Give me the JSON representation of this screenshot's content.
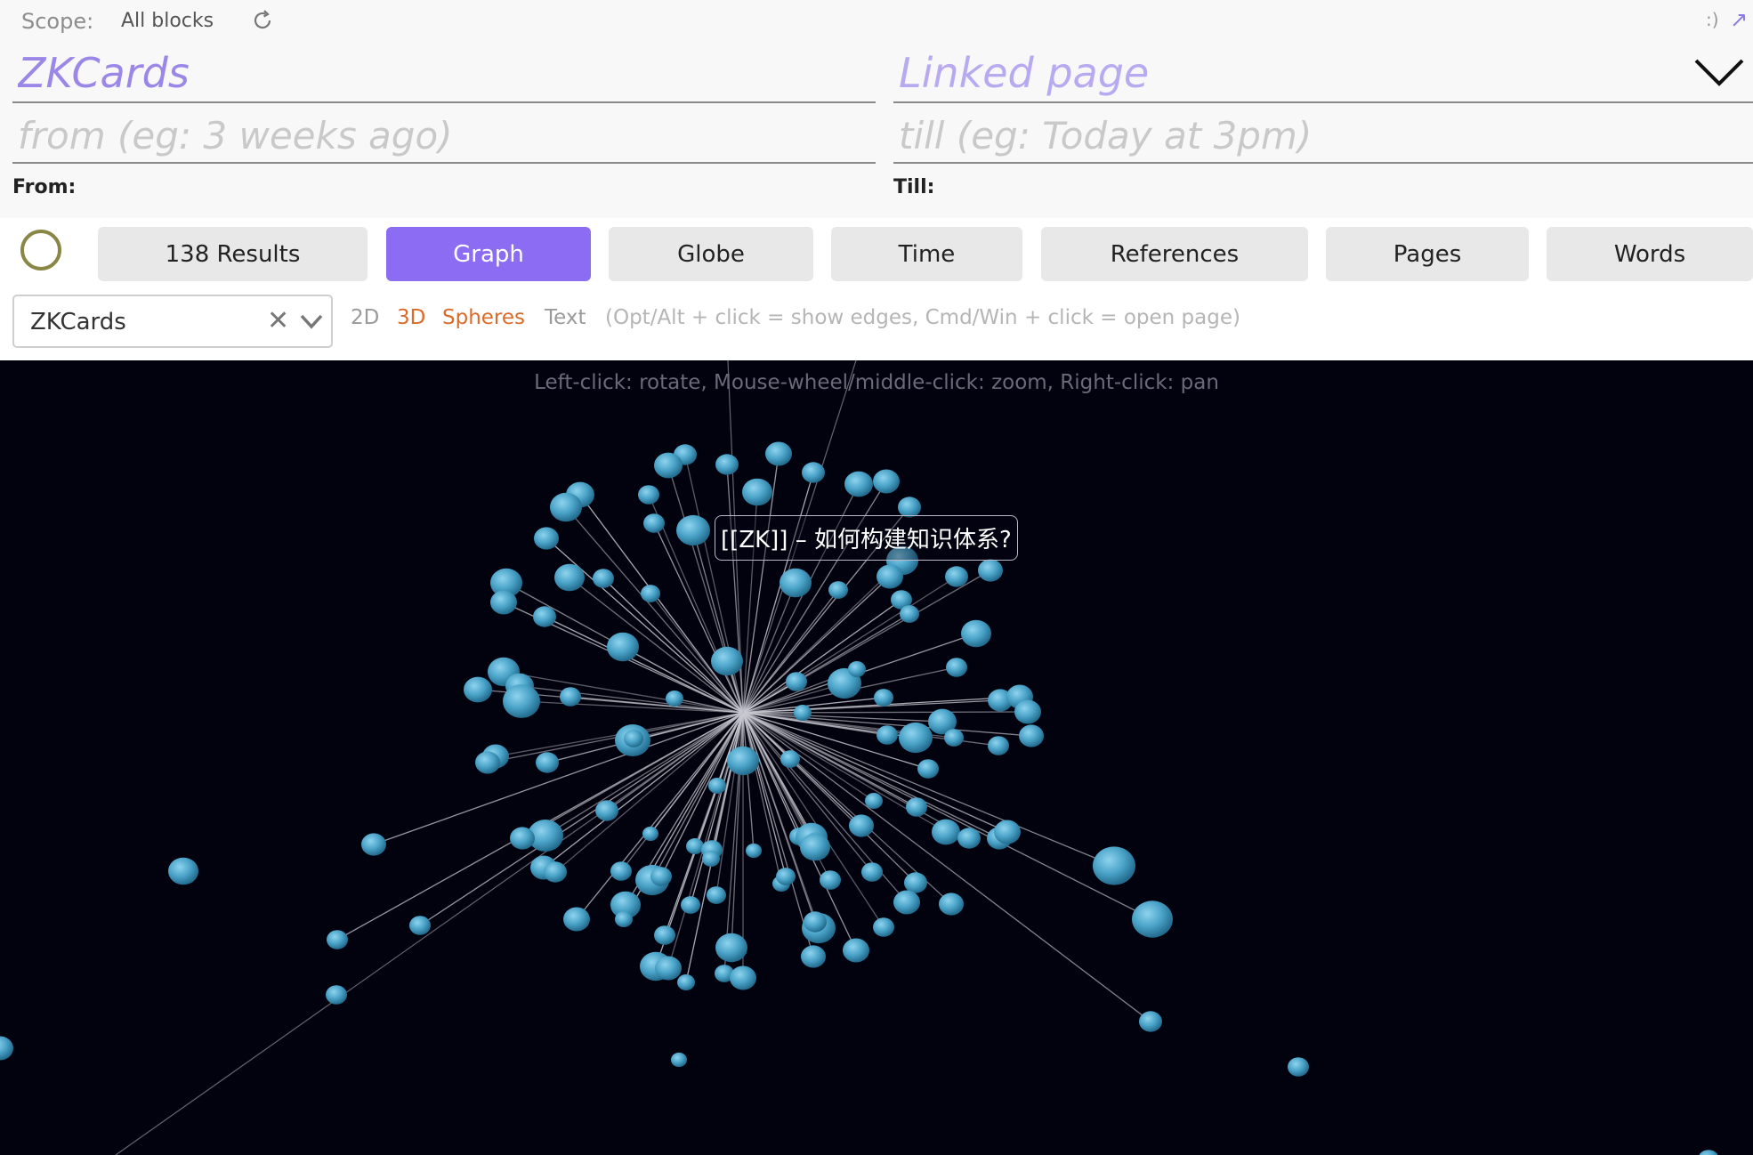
{
  "scope": {
    "label": "Scope:",
    "value": "All blocks"
  },
  "corner": {
    "smile": ":)",
    "arrow": "↗"
  },
  "query": {
    "title_value": "ZKCards",
    "linked_placeholder": "Linked page"
  },
  "dates": {
    "from_placeholder": "from (eg: 3 weeks ago)",
    "till_placeholder": "till (eg: Today at 3pm)",
    "from_label": "From:",
    "till_label": "Till:"
  },
  "tabs": [
    "138 Results",
    "Graph",
    "Globe",
    "Time",
    "References",
    "Pages",
    "Words"
  ],
  "active_tab": "Graph",
  "select": {
    "value": "ZKCards",
    "clear": "✕"
  },
  "view_options": {
    "dim2": "2D",
    "dim3": "3D",
    "spheres": "Spheres",
    "text": "Text",
    "hint": "(Opt/Alt + click = show edges, Cmd/Win + click = open page)"
  },
  "graph": {
    "hint": "Left-click: rotate, Mouse-wheel/middle-click: zoom, Right-click: pan",
    "tooltip": "[[ZK]] – 如何构建知识体系?"
  },
  "colors": {
    "accent": "#8b6cf2",
    "node": "#4aa3c8",
    "edge": "#c8c8d0",
    "graph_bg": "#02010e",
    "option_active": "#d96b2b"
  },
  "icons": [
    "refresh-icon",
    "chevron-down-icon",
    "clear-icon",
    "select-chevron-icon",
    "status-ring"
  ]
}
